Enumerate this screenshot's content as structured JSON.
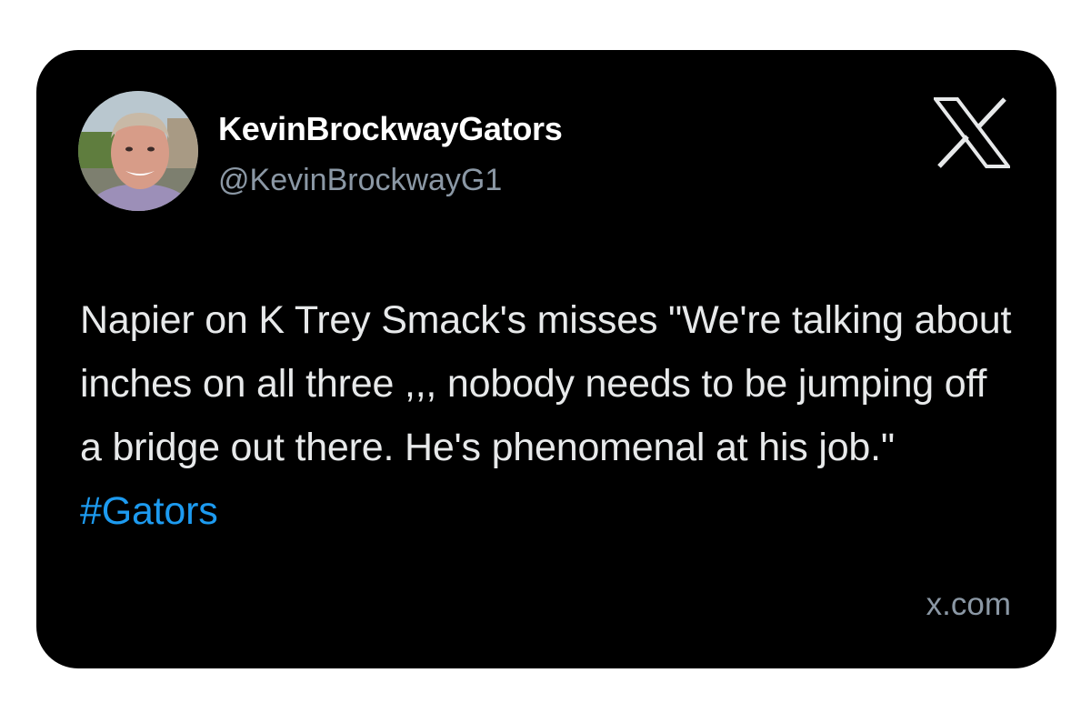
{
  "author": {
    "display_name": "KevinBrockwayGators",
    "handle": "@KevinBrockwayG1"
  },
  "tweet": {
    "text": "Napier on K Trey Smack's misses \"We're talking about inches on all three ,,, nobody needs to be jumping off a bridge out there. He's phenomenal at his job.\"",
    "hashtag": "#Gators"
  },
  "footer": {
    "source": "x.com"
  },
  "icons": {
    "logo": "x-logo-icon",
    "avatar": "avatar"
  },
  "colors": {
    "card_background": "#000000",
    "text_primary": "#e7e9ea",
    "text_secondary": "#8b98a5",
    "hashtag": "#1d9bf0"
  }
}
